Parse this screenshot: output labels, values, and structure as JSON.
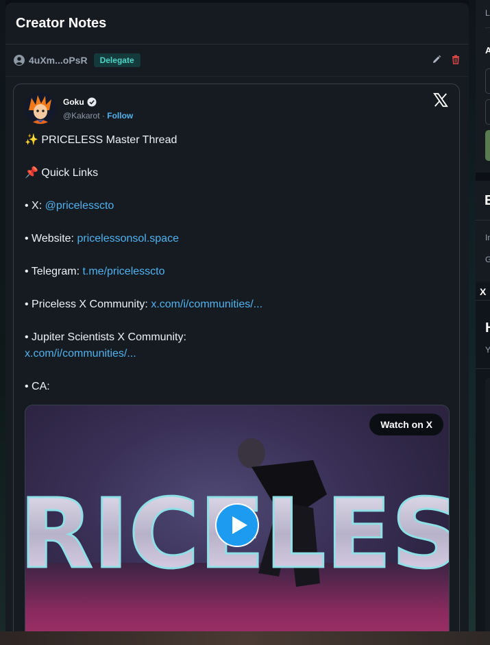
{
  "panel": {
    "title": "Creator Notes"
  },
  "note": {
    "author": "4uXm...oPsR",
    "role_badge": "Delegate"
  },
  "tweet": {
    "name": "Goku",
    "handle": "@Kakarot",
    "separator": "·",
    "follow_label": "Follow",
    "lines": {
      "title": "✨ PRICELESS Master Thread",
      "quick_links": "📌 Quick Links",
      "x_prefix": "• X: ",
      "x_link": "@pricelesscto",
      "website_prefix": "• Website: ",
      "website_link": "pricelessonsol.space",
      "telegram_prefix": "• Telegram: ",
      "telegram_link": "t.me/pricelesscto",
      "community_prefix": "• Priceless X Community: ",
      "community_link": "x.com/i/communities/...",
      "jupiter_prefix": "• Jupiter Scientists X Community:",
      "jupiter_link": "x.com/i/communities/...",
      "ca_prefix": "• CA:"
    },
    "video": {
      "watch_label": "Watch on X",
      "art_text": "PRICELESS"
    }
  },
  "right_column": {
    "t1": "L",
    "t2": "A",
    "t3": "E",
    "t4": "In",
    "t5": "G",
    "t6": "X",
    "t7": "H",
    "t8": "Y"
  },
  "colors": {
    "link": "#4eb3f0",
    "badge": "#4fd3c4",
    "delete": "#e04848"
  }
}
